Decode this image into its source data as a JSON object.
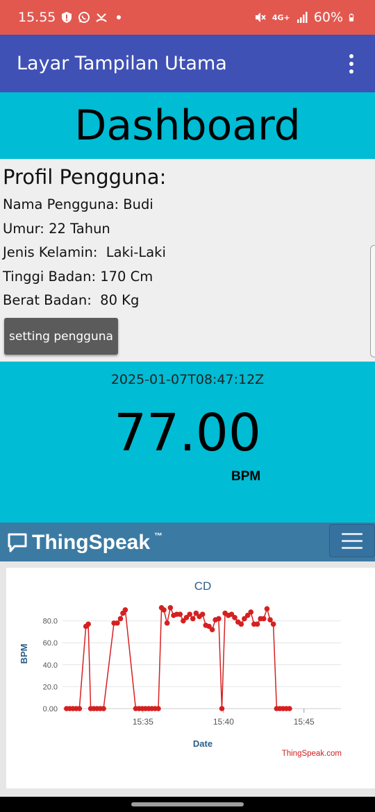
{
  "status_bar": {
    "time": "15.55",
    "battery": "60%",
    "network": "4G+",
    "icons": [
      "shield-alert-icon",
      "whatsapp-icon",
      "missed-call-icon",
      "dot-icon",
      "mute-icon",
      "network-4g-icon",
      "signal-icon",
      "battery-icon"
    ]
  },
  "app_bar": {
    "title": "Layar Tampilan Utama",
    "menu_icon": "more-vert-icon"
  },
  "dashboard": {
    "title": "Dashboard"
  },
  "profile": {
    "title": "Profil Pengguna:",
    "name": "Nama Pengguna: Budi",
    "age": "Umur: 22 Tahun",
    "gender": "Jenis Kelamin:  Laki-Laki",
    "height": "Tinggi Badan: 170 Cm",
    "weight": "Berat Badan:  80 Kg",
    "setting_button": "setting pengguna"
  },
  "reading": {
    "timestamp": "2025-01-07T08:47:12Z",
    "value": "77.00",
    "unit": "BPM"
  },
  "thingspeak": {
    "brand": "ThingSpeak",
    "trademark": "™",
    "menu_icon": "hamburger-icon"
  },
  "chart_data": {
    "type": "line",
    "title": "CD",
    "xlabel": "Date",
    "ylabel": "BPM",
    "credit": "ThingSpeak.com",
    "y_ticks": [
      "0.00",
      "20.0",
      "40.0",
      "60.0",
      "80.0"
    ],
    "x_ticks": [
      "15:35",
      "15:40",
      "15:45"
    ],
    "x_tick_values": [
      15.5833,
      15.6667,
      15.75
    ],
    "ylim": [
      0,
      100
    ],
    "xlim": [
      15.5,
      15.7883
    ],
    "line_color": "#d62020",
    "grid": true,
    "x_hours": [
      15.5042,
      15.5075,
      15.5108,
      15.5142,
      15.5175,
      15.5242,
      15.5267,
      15.5292,
      15.5325,
      15.5358,
      15.5392,
      15.5425,
      15.5533,
      15.5567,
      15.56,
      15.5625,
      15.565,
      15.5758,
      15.5792,
      15.5825,
      15.5858,
      15.5892,
      15.5925,
      15.5958,
      15.5992,
      15.6025,
      15.605,
      15.6083,
      15.6117,
      15.615,
      15.6183,
      15.6217,
      15.625,
      15.6283,
      15.6317,
      15.635,
      15.6383,
      15.6417,
      15.645,
      15.6483,
      15.6517,
      15.655,
      15.6583,
      15.6617,
      15.665,
      15.6683,
      15.6717,
      15.675,
      15.6783,
      15.6817,
      15.685,
      15.6883,
      15.6917,
      15.695,
      15.6983,
      15.7017,
      15.705,
      15.7083,
      15.7117,
      15.715,
      15.7183,
      15.7217,
      15.725,
      15.7283,
      15.7317,
      15.735
    ],
    "values": [
      0,
      0,
      0,
      0,
      0,
      75,
      77,
      0,
      0,
      0,
      0,
      0,
      78,
      78,
      82,
      87,
      90,
      0,
      0,
      0,
      0,
      0,
      0,
      0,
      0,
      92,
      90,
      78,
      92,
      85,
      86,
      86,
      80,
      83,
      86,
      82,
      87,
      84,
      86,
      76,
      75,
      72,
      81,
      82,
      0,
      87,
      85,
      86,
      83,
      79,
      77,
      82,
      85,
      88,
      77,
      77,
      82,
      82,
      91,
      81,
      77,
      0,
      0,
      0,
      0,
      0
    ]
  }
}
